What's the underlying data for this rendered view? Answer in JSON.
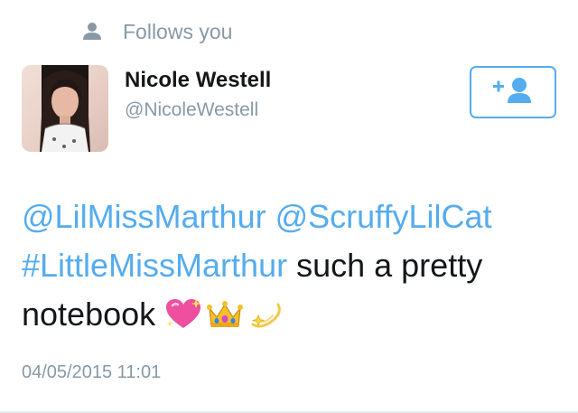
{
  "social_context": {
    "icon": "person-icon",
    "text": "Follows you"
  },
  "user": {
    "display_name": "Nicole Westell",
    "username": "@NicoleWestell",
    "avatar": "profile-photo"
  },
  "follow_button": {
    "icon": "add-user-icon",
    "color": "#55acee"
  },
  "tweet": {
    "mention_1": "@LilMissMarthur",
    "mention_2": "@ScruffyLilCat",
    "hashtag": "#LittleMissMarthur",
    "text_line_2_tail": " such a pretty",
    "text_line_3": "notebook",
    "emojis": [
      "sparkling-heart-emoji",
      "crown-emoji",
      "dizzy-emoji"
    ],
    "link_color": "#55acee"
  },
  "timestamp": "04/05/2015 11:01"
}
